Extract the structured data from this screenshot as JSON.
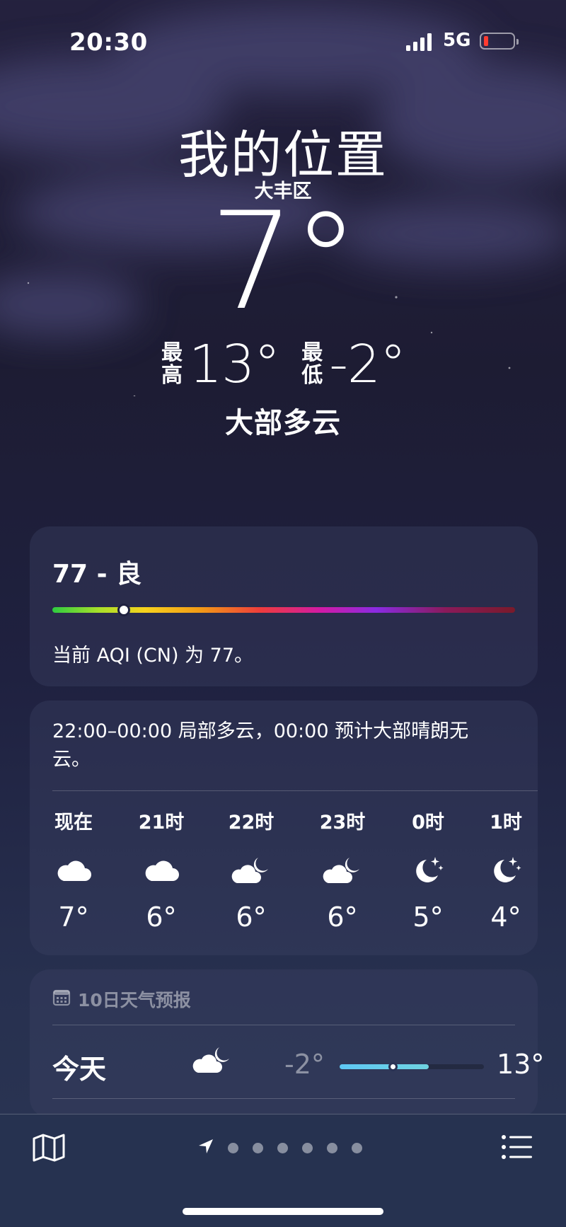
{
  "status_bar": {
    "time": "20:30",
    "network": "5G",
    "battery_color": "#ff3b30"
  },
  "hero": {
    "location": "我的位置",
    "district": "大丰区",
    "temperature": "7°",
    "high_label": "最高",
    "high": "13°",
    "low_label": "最低",
    "low": "-2°",
    "condition": "大部多云"
  },
  "aqi_card": {
    "value_label": "77 - 良",
    "scale_position": 0.15,
    "description": "当前 AQI (CN) 为 77。"
  },
  "hourly_card": {
    "summary": "22:00–00:00 局部多云，00:00 预计大部晴朗无云。",
    "hours": [
      {
        "label": "现在",
        "icon": "cloud-icon",
        "temp": "7°"
      },
      {
        "label": "21时",
        "icon": "cloud-icon",
        "temp": "6°"
      },
      {
        "label": "22时",
        "icon": "cloud-moon-icon",
        "temp": "6°"
      },
      {
        "label": "23时",
        "icon": "cloud-moon-icon",
        "temp": "6°"
      },
      {
        "label": "0时",
        "icon": "moon-stars-icon",
        "temp": "5°"
      },
      {
        "label": "1时",
        "icon": "moon-stars-icon",
        "temp": "4°"
      }
    ]
  },
  "forecast_card": {
    "header": "10日天气预报",
    "header_icon": "calendar-icon",
    "rows": [
      {
        "day": "今天",
        "icon": "cloud-moon-icon",
        "low": "-2°",
        "high": "13°",
        "range_start": 0.0,
        "range_end": 0.62,
        "current": 0.36
      }
    ]
  },
  "tab_bar": {
    "map_icon": "map-icon",
    "location_icon": "location-arrow-icon",
    "page_count": 6,
    "list_icon": "list-icon"
  }
}
